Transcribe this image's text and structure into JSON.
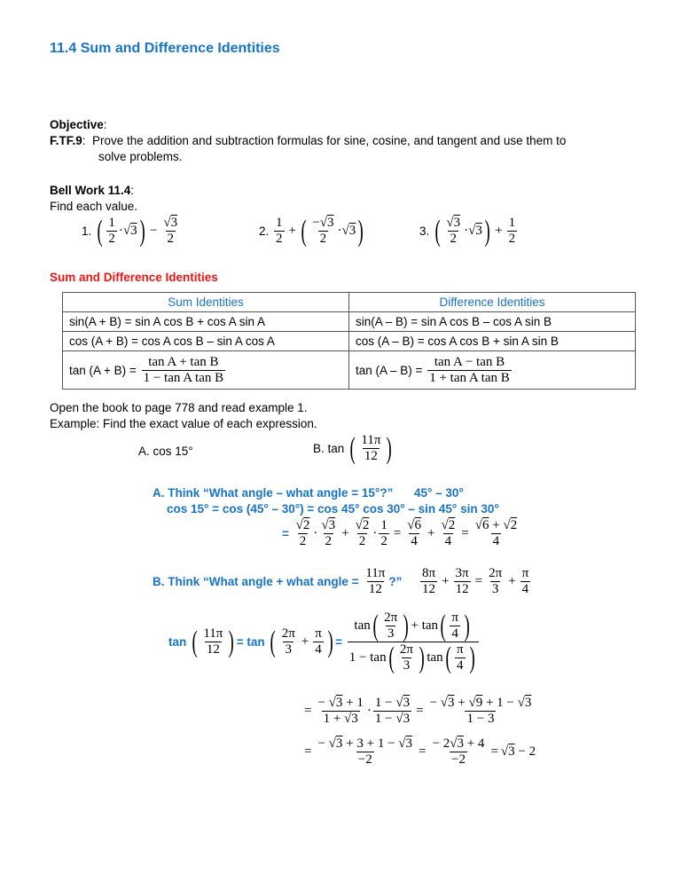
{
  "title": "11.4 Sum and Difference Identities",
  "objective": {
    "label": "Objective",
    "code": "F.TF.9",
    "text_line1": "Prove the addition and subtraction formulas for sine, cosine, and tangent and use them to",
    "text_line2": "solve problems."
  },
  "bell_work": {
    "label": "Bell Work 11.4",
    "instruction": "Find each value.",
    "problems": [
      {
        "number": "1.",
        "expression": "(1/2 · √3) − √3/2"
      },
      {
        "number": "2.",
        "expression": "1/2 + (−√3/2 · √3)"
      },
      {
        "number": "3.",
        "expression": "(√3/2 · √3) + 1/2"
      }
    ]
  },
  "identities": {
    "heading": "Sum and Difference Identities",
    "sum_header": "Sum Identities",
    "diff_header": "Difference Identities",
    "sum": {
      "sin": "sin(A + B) = sin A cos B + cos A sin A",
      "cos": "cos (A + B) = cos A cos B – sin A cos A",
      "tan_label": "tan (A + B) =",
      "tan_num": "tan A + tan B",
      "tan_den": "1 − tan A tan B"
    },
    "diff": {
      "sin": "sin(A – B) = sin A cos B – cos A sin B",
      "cos": "cos (A – B) = cos A cos B + sin A sin B",
      "tan_label": "tan (A – B) =",
      "tan_num": "tan A − tan B",
      "tan_den": "1 + tan A tan B"
    }
  },
  "example": {
    "line1": "Open the book to page 778 and read example 1.",
    "line2": "Example:  Find the exact value of each expression.",
    "a_label": "A.  cos 15°",
    "b_label": "B.  tan",
    "b_num": "11π",
    "b_den": "12"
  },
  "solution_a": {
    "think": "A.  Think “What angle – what angle = 15°?”",
    "answer_angles": "45° – 30°",
    "expand": "cos 15° = cos (45° – 30°) = cos 45° cos 30° – sin 45° sin 30°",
    "eq": "=",
    "result": "(√6 + √2)/4"
  },
  "solution_b": {
    "think_prefix": "B.  Think “What angle + what angle =",
    "think_num": "11π",
    "think_den": "12",
    "think_suffix": "?”",
    "tan_word": "tan",
    "eq_tan": "= tan",
    "eq": "=",
    "step1": "(−√3 + 1)/(1 + √3) · (1 − √3)/(1 − √3) = (−√3 + √9 + 1 − √3)/(1 − 3)",
    "step2": "(−√3 + 3 + 1 − √3)/(−2) = (−2√3 + 4)/(−2) = √3 − 2"
  }
}
